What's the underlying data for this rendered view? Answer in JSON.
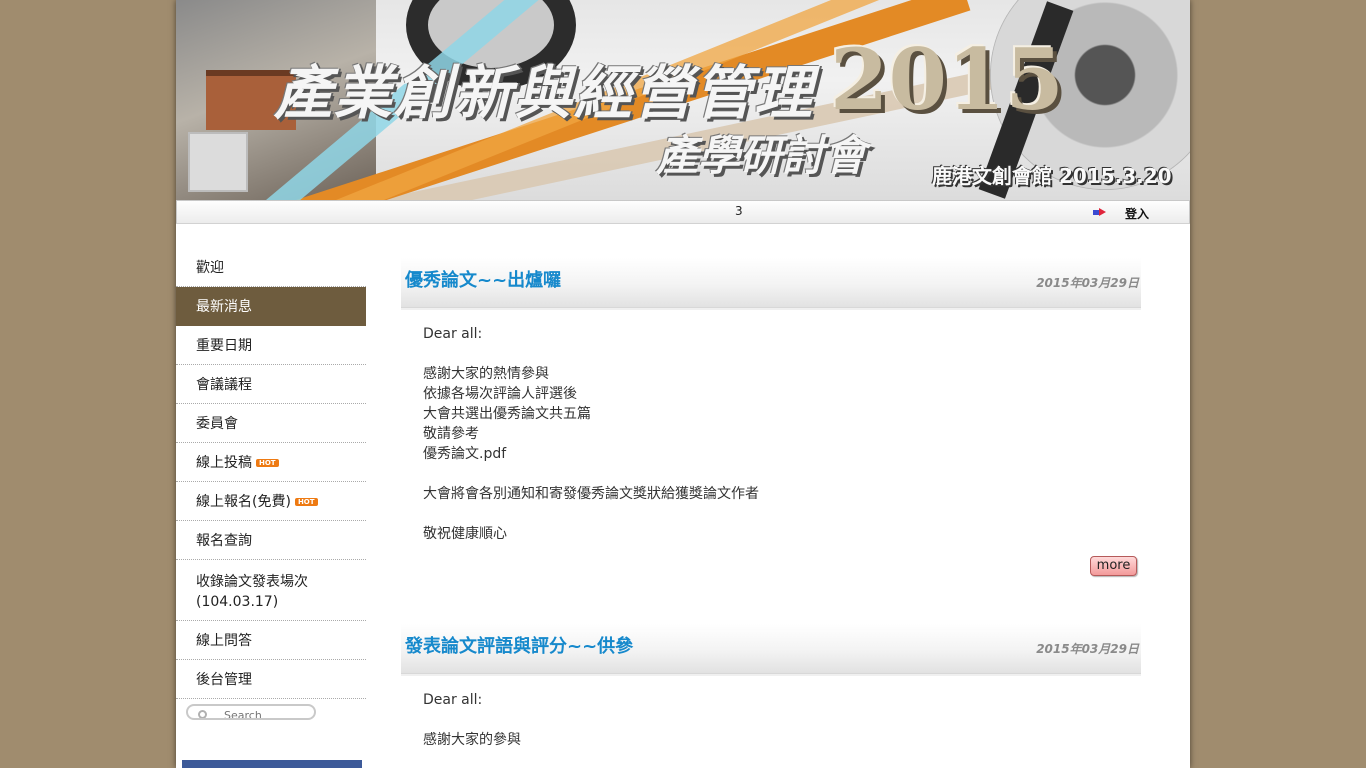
{
  "banner": {
    "title_main": "產業創新與經營管理",
    "title_year": "2015",
    "title_sub": "產學研討會",
    "venue": "鹿港文創會館  2015.3.20"
  },
  "topbar": {
    "counter": "3",
    "login_label": "登入"
  },
  "sidebar": {
    "items": [
      {
        "label": "歡迎"
      },
      {
        "label": "最新消息"
      },
      {
        "label": "重要日期"
      },
      {
        "label": "會議議程"
      },
      {
        "label": "委員會"
      },
      {
        "label": "線上投稿",
        "badge": "HOT"
      },
      {
        "label": "線上報名(免費)",
        "badge": "HOT"
      },
      {
        "label": "報名查詢"
      },
      {
        "label": "收錄論文發表場次",
        "label2": "(104.03.17)"
      },
      {
        "label": "線上問答"
      },
      {
        "label": "後台管理"
      }
    ],
    "search_placeholder": "Search"
  },
  "posts": [
    {
      "title": "優秀論文~~出爐囉",
      "date": "2015年03月29日",
      "lines": [
        "Dear all:",
        "",
        "感謝大家的熱情參與",
        "依據各場次評論人評選後",
        "大會共選出優秀論文共五篇",
        "敬請參考",
        "優秀論文.pdf",
        "",
        "大會將會各別通知和寄發優秀論文獎狀給獲獎論文作者",
        "",
        "敬祝健康順心"
      ],
      "more_label": "more"
    },
    {
      "title": "發表論文評語與評分~~供參",
      "date": "2015年03月29日",
      "lines": [
        "Dear all:",
        "",
        "感謝大家的參與"
      ]
    }
  ],
  "colors": {
    "background": "#a08c6e",
    "nav_active": "#6e5c3e",
    "title_link": "#1689cc",
    "badge": "#ee7a12"
  }
}
